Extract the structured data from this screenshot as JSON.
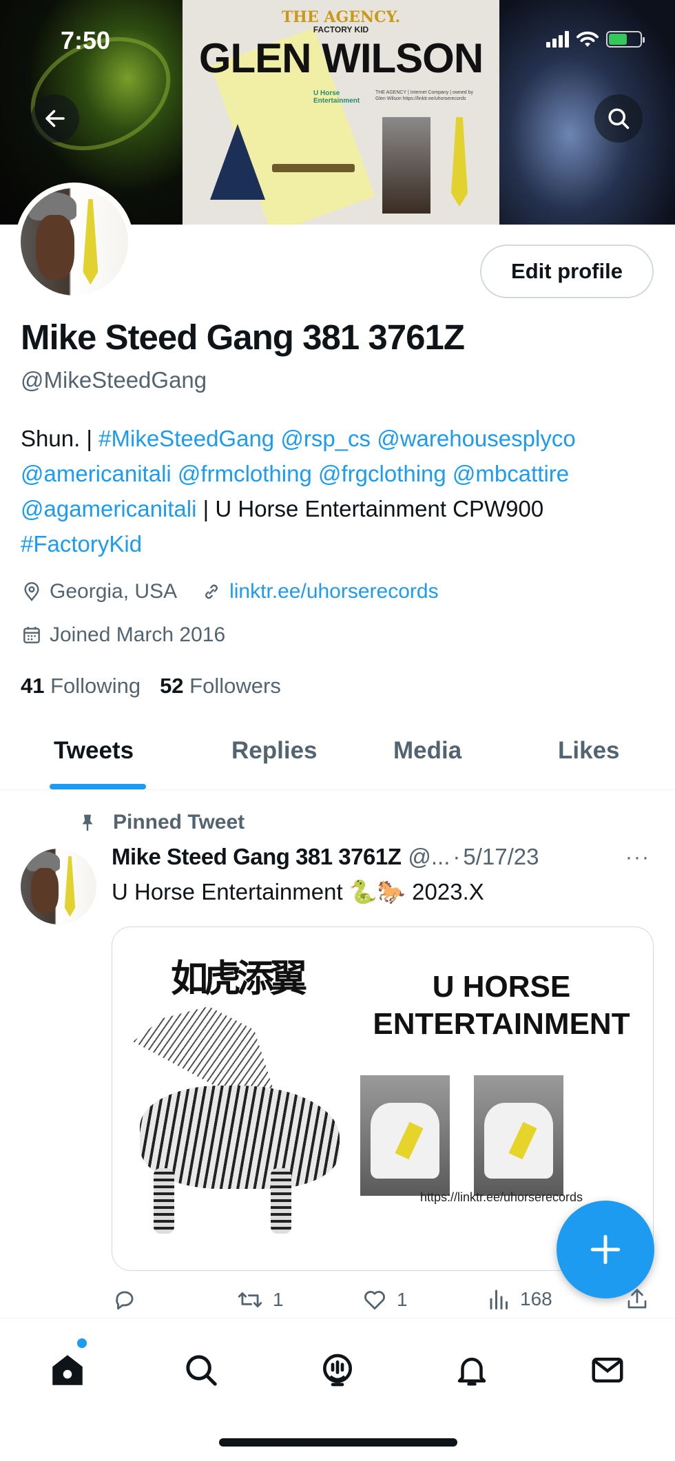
{
  "status_bar": {
    "time": "7:50",
    "battery_level": 0.6,
    "battery_color": "#34c759"
  },
  "banner": {
    "agency_text": "THE AGENCY.",
    "factory_kid_text": "FACTORY KID",
    "glen_wilson_text": "GLEN WILSON",
    "small_text": "THE AGENCY | Internet Company | owned by Glen Wilson https://linktr.ee/uhorserecords",
    "horse_text": "U Horse Entertainment"
  },
  "header_buttons": {
    "back_icon": "arrow-left-icon",
    "search_icon": "search-icon"
  },
  "profile": {
    "edit_label": "Edit profile",
    "name": "Mike Steed Gang 381 3761Z",
    "handle": "@MikeSteedGang",
    "bio": {
      "p1": "Shun. | ",
      "l1": "#MikeSteedGang",
      "l2": "@rsp_cs",
      "l3": "@warehousesplyco",
      "l4": "@americanitali",
      "l5": "@frmclothing",
      "l6": "@frgclothing",
      "l7": "@mbcattire",
      "l8": "@agamericanitali",
      "p2": " | U Horse Entertainment CPW900",
      "l9": "#FactoryKid"
    },
    "location": "Georgia, USA",
    "website": "linktr.ee/uhorserecords",
    "joined": "Joined March 2016",
    "following_count": "41",
    "following_label": "Following",
    "followers_count": "52",
    "followers_label": "Followers"
  },
  "tabs": [
    {
      "label": "Tweets",
      "active": true
    },
    {
      "label": "Replies",
      "active": false
    },
    {
      "label": "Media",
      "active": false
    },
    {
      "label": "Likes",
      "active": false
    }
  ],
  "pinned_tweet": {
    "pinned_label": "Pinned Tweet",
    "author_name": "Mike Steed Gang 381 3761Z",
    "author_handle": "@...",
    "sep": "·",
    "date": "5/17/23",
    "more": "···",
    "text": "U Horse Entertainment 🐍🐎 2023.X",
    "media": {
      "calligraphy": "如虎添翼",
      "title_line1": "U HORSE",
      "title_line2": "ENTERTAINMENT",
      "url": "https://linktr.ee/uhorserecords"
    },
    "actions": {
      "reply_count": "",
      "retweet_count": "1",
      "like_count": "1",
      "views_count": "168"
    }
  },
  "fab_icon": "plus-icon",
  "bottom_nav": [
    "home-icon",
    "search-icon",
    "spaces-icon",
    "notifications-icon",
    "messages-icon"
  ],
  "colors": {
    "accent": "#1d9bf0",
    "text_primary": "#0f1419",
    "text_secondary": "#536471"
  }
}
